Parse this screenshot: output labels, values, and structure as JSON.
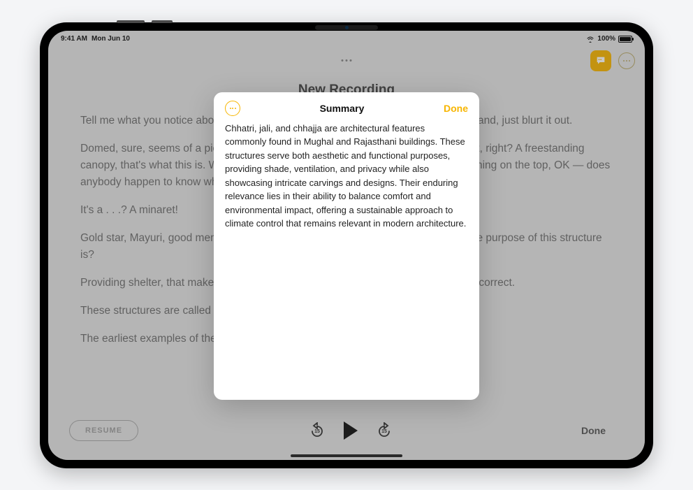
{
  "status": {
    "time": "9:41 AM",
    "date": "Mon Jun 10",
    "battery_pct": "100%"
  },
  "page": {
    "title": "New Recording",
    "paragraphs": [
      "Tell me what you notice about this image. What is it? You don't need to raise your hand, just blurt it out.",
      "Domed, sure, seems of a piece with the rest of the architecture that we've looked at, right? A freestanding canopy, that's what this is. What else? Ornate, yeah, a ton of fine carvings. Pointy thing on the top, OK — does anybody happen to know what that's called?",
      "It's a . . .? A minaret!",
      "Gold star, Mayuri, good memory. Uh-huh. Can anyone tell me what they imagine the purpose of this structure is?",
      "Providing shelter, that makes sense, right? Shade from the sun, you are absolutely correct.",
      "These structures are called chhatri.",
      "The earliest examples of these come from the 16th century in Gujarat, but we"
    ]
  },
  "modal": {
    "title": "Summary",
    "done_label": "Done",
    "body": "Chhatri, jali, and chhajja are architectural features commonly found in Mughal and Rajasthani buildings. These structures serve both aesthetic and functional purposes, providing shade, ventilation, and privacy while also showcasing intricate carvings and designs. Their enduring relevance lies in their ability to balance comfort and environmental impact, offering a sustainable approach to climate control that remains relevant in modern architecture."
  },
  "playbar": {
    "resume_label": "RESUME",
    "done_label": "Done"
  }
}
